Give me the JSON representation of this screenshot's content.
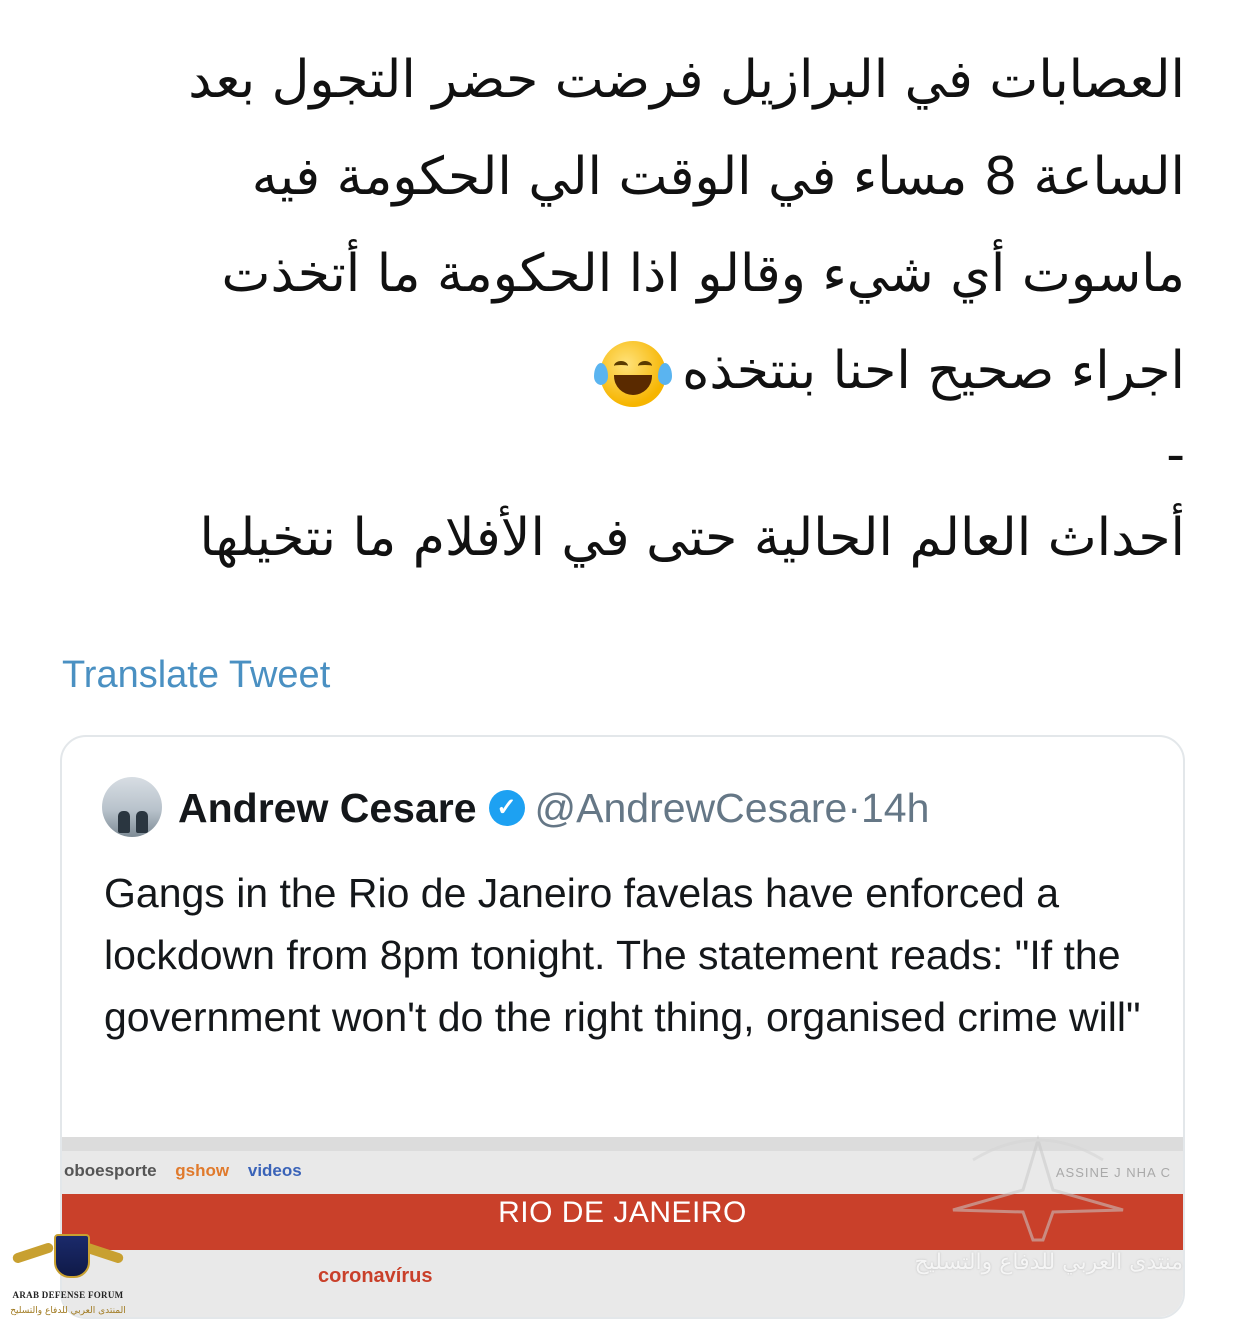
{
  "tweet": {
    "text_lines": [
      "العصابات في البرازيل فرضت حضر التجول بعد",
      "الساعة 8 مساء في الوقت الي الحكومة فيه",
      "ماسوت أي شيء وقالو اذا الحكومة ما أتخذت",
      "اجراء صحيح احنا بنتخذه"
    ],
    "dash": "-",
    "closing_line": "أحداث العالم الحالية حتى في الأفلام ما نتخيلها",
    "emoji_icon": "face-with-tears-of-joy-icon",
    "translate_label": "Translate Tweet"
  },
  "quoted": {
    "name": "Andrew Cesare",
    "handle": "@AndrewCesare",
    "separator": "·",
    "time": "14h",
    "verified_icon": "verified-badge-icon",
    "body": "Gangs in the Rio de Janeiro favelas have enforced a lockdown from 8pm tonight. The statement reads: \"If the government won't do the right thing, organised crime will\"",
    "media": {
      "nav": [
        "oboesporte",
        "gshow",
        "videos"
      ],
      "caption_right": "ASSINE  J    NHA C",
      "band_text": "RIO DE JANEIRO",
      "sub_link": "coronavírus"
    }
  },
  "watermark": {
    "text": "منتدى العربي للدفاع والتسليح"
  },
  "logo": {
    "title": "ARAB DEFENSE FORUM",
    "subtitle": "المنتدى العربي للدفاع والتسليح"
  },
  "colors": {
    "link_blue": "#4a90c2",
    "verified_blue": "#1da1f2",
    "muted_gray": "#657786",
    "band_red": "#c9402a"
  }
}
